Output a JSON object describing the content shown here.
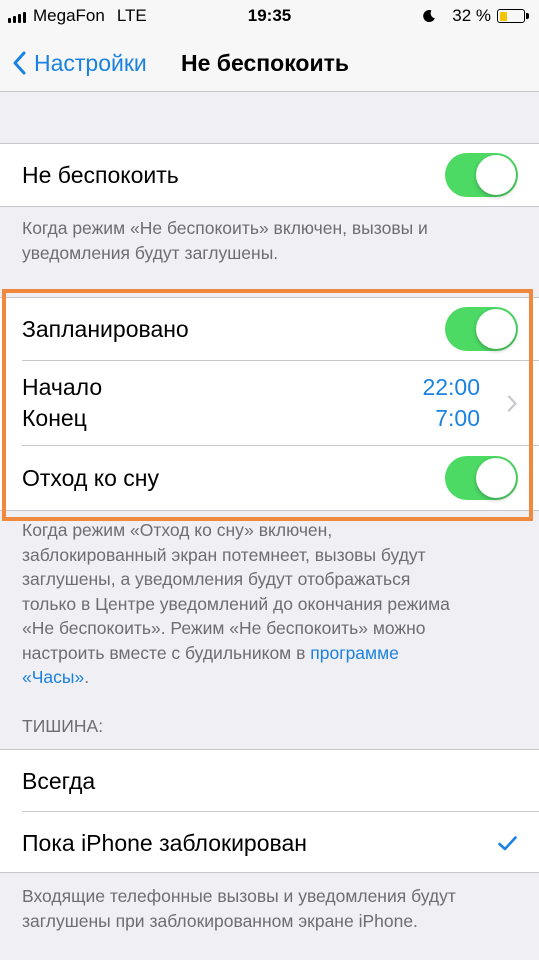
{
  "status_bar": {
    "carrier": "MegaFon",
    "network": "LTE",
    "time": "19:35",
    "battery_percent": "32 %",
    "battery_level": 0.32,
    "dnd_icon": "moon-icon"
  },
  "nav": {
    "back_label": "Настройки",
    "title": "Не беспокоить"
  },
  "dnd_toggle": {
    "label": "Не беспокоить",
    "on": true
  },
  "dnd_footer": "Когда режим «Не беспокоить» включен, вызовы и уведомления будут заглушены.",
  "scheduled": {
    "label": "Запланировано",
    "on": true,
    "start_label": "Начало",
    "start_value": "22:00",
    "end_label": "Конец",
    "end_value": "7:00",
    "bedtime_label": "Отход ко сну",
    "bedtime_on": true
  },
  "bedtime_footer": {
    "lines": [
      "Когда режим «Отход ко сну» включен,",
      "заблокированный экран потемнеет, вызовы будут",
      "заглушены, а уведомления будут отображаться",
      "только в Центре уведомлений до окончания режима",
      "«Не беспокоить». Режим «Не беспокоить» можно",
      "настроить вместе с будильником в "
    ],
    "link_part1": "программе",
    "link_part2": "«Часы»",
    "tail": "."
  },
  "silence": {
    "header": "ТИШИНА:",
    "options": [
      {
        "label": "Всегда",
        "selected": false
      },
      {
        "label": "Пока iPhone заблокирован",
        "selected": true
      }
    ],
    "footer_lines": [
      "Входящие телефонные вызовы и уведомления будут",
      "заглушены при заблокированном экране iPhone."
    ]
  },
  "colors": {
    "accent": "#1a82e0",
    "toggle_on": "#4cd964",
    "highlight": "#f0883e",
    "background": "#efeff4"
  }
}
